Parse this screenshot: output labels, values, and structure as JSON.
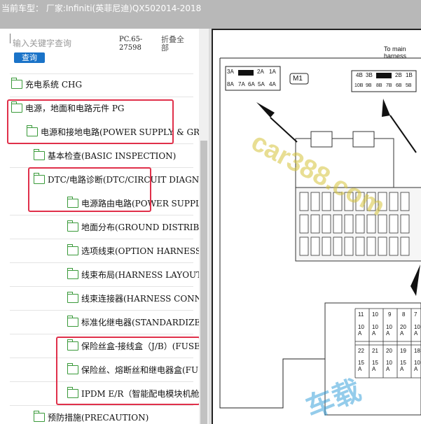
{
  "title": "当前车型： 厂家:Infiniti(英菲尼迪)QX502014-2018",
  "search": {
    "placeholder": "输入关键字查询",
    "button": "查询"
  },
  "code": "PC.65-27598",
  "collapse_label": "折叠全部",
  "tree": [
    {
      "label": "充电系统 CHG",
      "level": 0
    },
    {
      "label": "电源，地面和电路元件 PG",
      "level": 0
    },
    {
      "label": "电源和接地电路(POWER SUPPLY & GROUND",
      "level": 1
    },
    {
      "label": "基本检查(BASIC INSPECTION)",
      "level": 2
    },
    {
      "label": "DTC/电路诊断(DTC/CIRCUIT DIAGNOSIS)",
      "level": 2
    },
    {
      "label": "电源路由电路(POWER SUPPLY ROUTING)",
      "level": 3
    },
    {
      "label": "地面分布(GROUND DISTRIBUTION)",
      "level": 3
    },
    {
      "label": "选项线束(OPTION HARNESS)",
      "level": 3
    },
    {
      "label": "线束布局(HARNESS LAYOUT)",
      "level": 3
    },
    {
      "label": "线束连接器(HARNESS CONNECTOR)",
      "level": 3
    },
    {
      "label": "标准化继电器(STANDARDIZED RELAY)",
      "level": 3
    },
    {
      "label": "保险丝盒-接线盒（J/B）(FUSE BLOCK)",
      "level": 3
    },
    {
      "label": "保险丝、熔断丝和继电器盒(FUSE)",
      "level": 3
    },
    {
      "label": "IPDM E/R（智能配电模块机舱）",
      "level": 3
    },
    {
      "label": "预防措施(PRECAUTION)",
      "level": 2
    }
  ],
  "diagram": {
    "header_text": "To main harness",
    "left_conn_top": [
      "3A",
      "2A",
      "1A"
    ],
    "left_conn_bottom": [
      "8A",
      "7A",
      "6A",
      "5A",
      "4A"
    ],
    "m1_label": "M1",
    "right_conn_top": [
      "4B",
      "3B",
      "2B",
      "1B"
    ],
    "right_conn_bottom": [
      "10B",
      "9B",
      "8B",
      "7B",
      "6B",
      "5B"
    ],
    "fuse_numbers_row1": [
      "11",
      "10",
      "9",
      "8",
      "7"
    ],
    "fuse_amps_row1": [
      "10 A",
      "10 A",
      "10 A",
      "20 A",
      "10 A"
    ],
    "fuse_numbers_row2": [
      "22",
      "21",
      "20",
      "19",
      "18"
    ],
    "fuse_amps_row2": [
      "15 A",
      "15 A",
      "10 A",
      "15 A",
      "10 A"
    ],
    "watermark": "car388.com"
  }
}
